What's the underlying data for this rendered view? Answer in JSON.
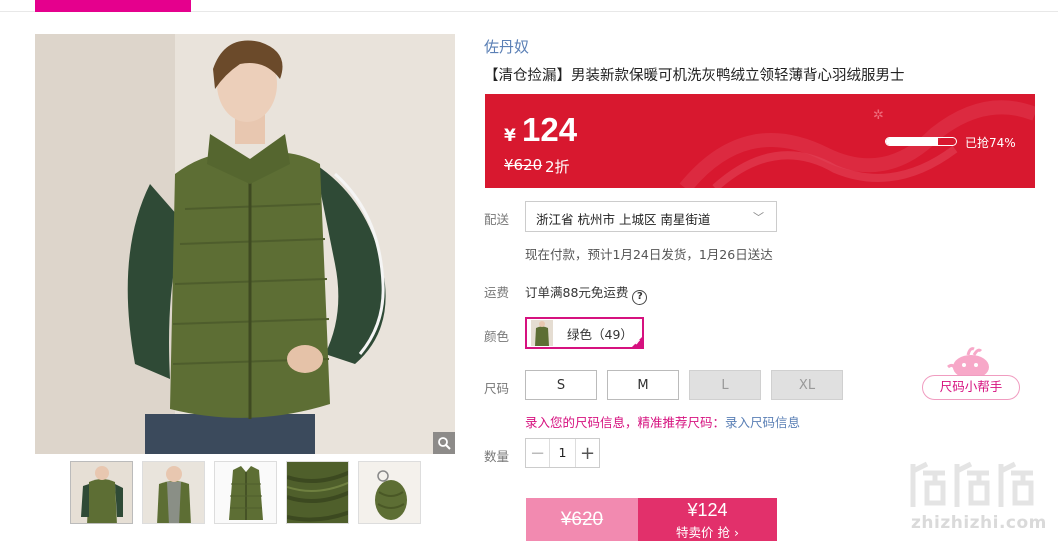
{
  "product": {
    "brand": "佐丹奴",
    "title": "【清仓捡漏】男装新款保暖可机洗灰鸭绒立领轻薄背心羽绒服男士"
  },
  "price": {
    "currency": "¥",
    "current": "124",
    "original": "¥620",
    "discount": "2折",
    "sold_label": "已抢74%",
    "sold_fraction": 0.74
  },
  "delivery": {
    "label": "配送",
    "address": "浙江省 杭州市 上城区 南星街道",
    "note": "现在付款，预计1月24日发货，1月26日送达"
  },
  "freight": {
    "label": "运费",
    "text": "订单满88元免运费"
  },
  "color": {
    "label": "颜色",
    "option": "绿色（49）"
  },
  "size": {
    "label": "尺码",
    "options": [
      {
        "label": "S",
        "available": true
      },
      {
        "label": "M",
        "available": true
      },
      {
        "label": "L",
        "available": false
      },
      {
        "label": "XL",
        "available": false
      }
    ],
    "tip": "录入您的尺码信息，精准推荐尺码：",
    "tip_link": "录入尺码信息",
    "helper": "尺码小帮手"
  },
  "quantity": {
    "label": "数量",
    "value": "1"
  },
  "buy": {
    "original": "¥620",
    "price": "¥124",
    "action": "特卖价 抢 ›"
  },
  "watermark": {
    "text": "zhizhizhi.com"
  },
  "colors": {
    "brand_pink": "#e5008d",
    "price_red": "#d8182f",
    "buy_pink": "#e2306b",
    "link_blue": "#5a7fb5"
  }
}
